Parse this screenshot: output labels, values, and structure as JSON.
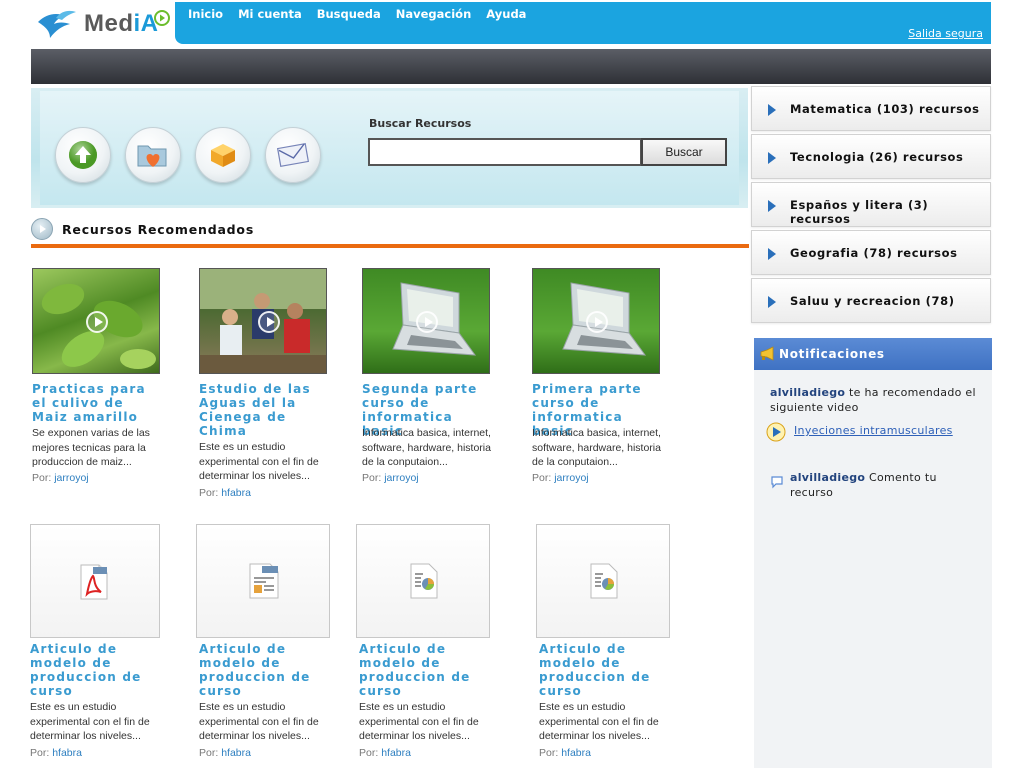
{
  "logo": {
    "prefix": "Med",
    "accent": "iA"
  },
  "nav": {
    "links": [
      "Inicio",
      "Mi cuenta",
      "Busqueda",
      "Navegación",
      "Ayuda"
    ],
    "secure_exit": "Salida segura"
  },
  "search": {
    "label": "Buscar Recursos",
    "value": "",
    "button": "Buscar"
  },
  "recommended": {
    "title": "Recursos Recomendados",
    "by_prefix": "Por:",
    "items": [
      {
        "title": "Practicas para el culivo de Maiz amarillo",
        "desc": "Se exponen varias de las mejores tecnicas para la produccion de maiz...",
        "author": "jarroyoj",
        "kind": "video",
        "thumb": "plant-photo"
      },
      {
        "title": "Estudio de las Aguas del la Cienega de Chima",
        "desc": "Este es un estudio experimental con el fin de determinar los niveles...",
        "author": "hfabra",
        "kind": "video",
        "thumb": "people-photo"
      },
      {
        "title": "Segunda parte curso de informatica basic",
        "desc": "Informatica basica, internet, software, hardware, historia de la conputaion...",
        "author": "jarroyoj",
        "kind": "video",
        "thumb": "laptop-photo"
      },
      {
        "title": "Primera parte curso de informatica basic",
        "desc": "Informatica basica, internet, software, hardware, historia de la conputaion...",
        "author": "jarroyoj",
        "kind": "video",
        "thumb": "laptop-photo"
      },
      {
        "title": "Articulo de modelo de produccion de curso",
        "desc": "Este es un estudio experimental con el fin de determinar los niveles...",
        "author": "hfabra",
        "kind": "pdf",
        "thumb": "pdf-icon"
      },
      {
        "title": "Articulo de modelo de produccion de curso",
        "desc": "Este es un estudio experimental con el fin de determinar los niveles...",
        "author": "hfabra",
        "kind": "sdw",
        "thumb": "sdw-document-icon"
      },
      {
        "title": "Articulo de modelo de produccion de curso",
        "desc": "Este es un estudio experimental con el fin de determinar los niveles...",
        "author": "hfabra",
        "kind": "presentation",
        "thumb": "presentation-icon"
      },
      {
        "title": "Articulo de modelo de produccion de curso",
        "desc": "Este es un estudio experimental con el fin de determinar los niveles...",
        "author": "hfabra",
        "kind": "presentation",
        "thumb": "presentation-icon"
      }
    ]
  },
  "categories": [
    "Matematica (103) recursos",
    "Tecnologia (26) recursos",
    "Españos y litera (3) recursos",
    "Geografia (78) recursos",
    "Saluu y recreacion (78)"
  ],
  "notifications": {
    "title": "Notificaciones",
    "items": [
      {
        "user": "alvilladiego",
        "text": "te ha recomendado el siguiente video",
        "link": "Inyeciones intramusculares"
      },
      {
        "user": "alvilladiego",
        "text": "Comento tu recurso"
      }
    ]
  },
  "colors": {
    "nav": "#1ba4e0",
    "accent_line": "#ea6a10",
    "title_blue": "#3a9bd0",
    "notif_header": "#4a7ecb"
  }
}
